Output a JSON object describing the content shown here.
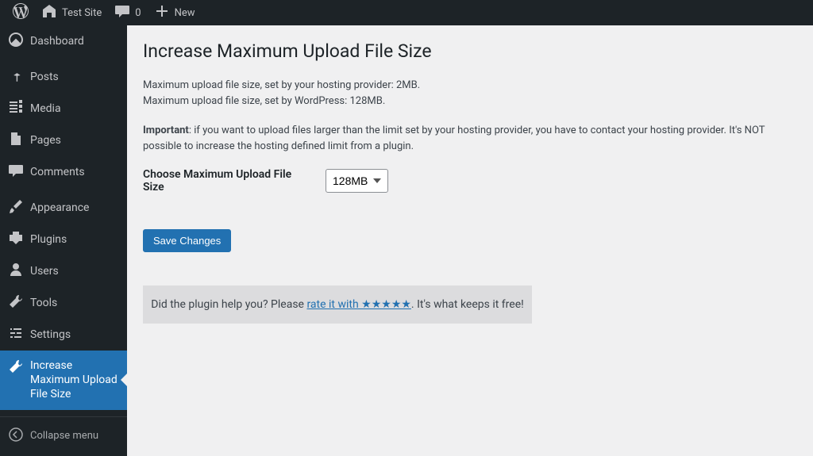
{
  "adminbar": {
    "site_name": "Test Site",
    "comments_count": "0",
    "new_label": "New"
  },
  "sidebar": {
    "dashboard": "Dashboard",
    "posts": "Posts",
    "media": "Media",
    "pages": "Pages",
    "comments": "Comments",
    "appearance": "Appearance",
    "plugins": "Plugins",
    "users": "Users",
    "tools": "Tools",
    "settings": "Settings",
    "current": "Increase Maximum Upload File Size",
    "collapse": "Collapse menu"
  },
  "page": {
    "title": "Increase Maximum Upload File Size",
    "line1": "Maximum upload file size, set by your hosting provider: 2MB.",
    "line2": "Maximum upload file size, set by WordPress: 128MB.",
    "important_label": "Important",
    "important_text": ": if you want to upload files larger than the limit set by your hosting provider, you have to contact your hosting provider. It's NOT possible to increase the hosting defined limit from a plugin.",
    "choose_label": "Choose Maximum Upload File Size",
    "select_value": "128MB",
    "save_label": "Save Changes",
    "rate_prefix": "Did the plugin help you? Please ",
    "rate_link": "rate it with ★★★★★",
    "rate_suffix": ". It's what keeps it free!"
  }
}
